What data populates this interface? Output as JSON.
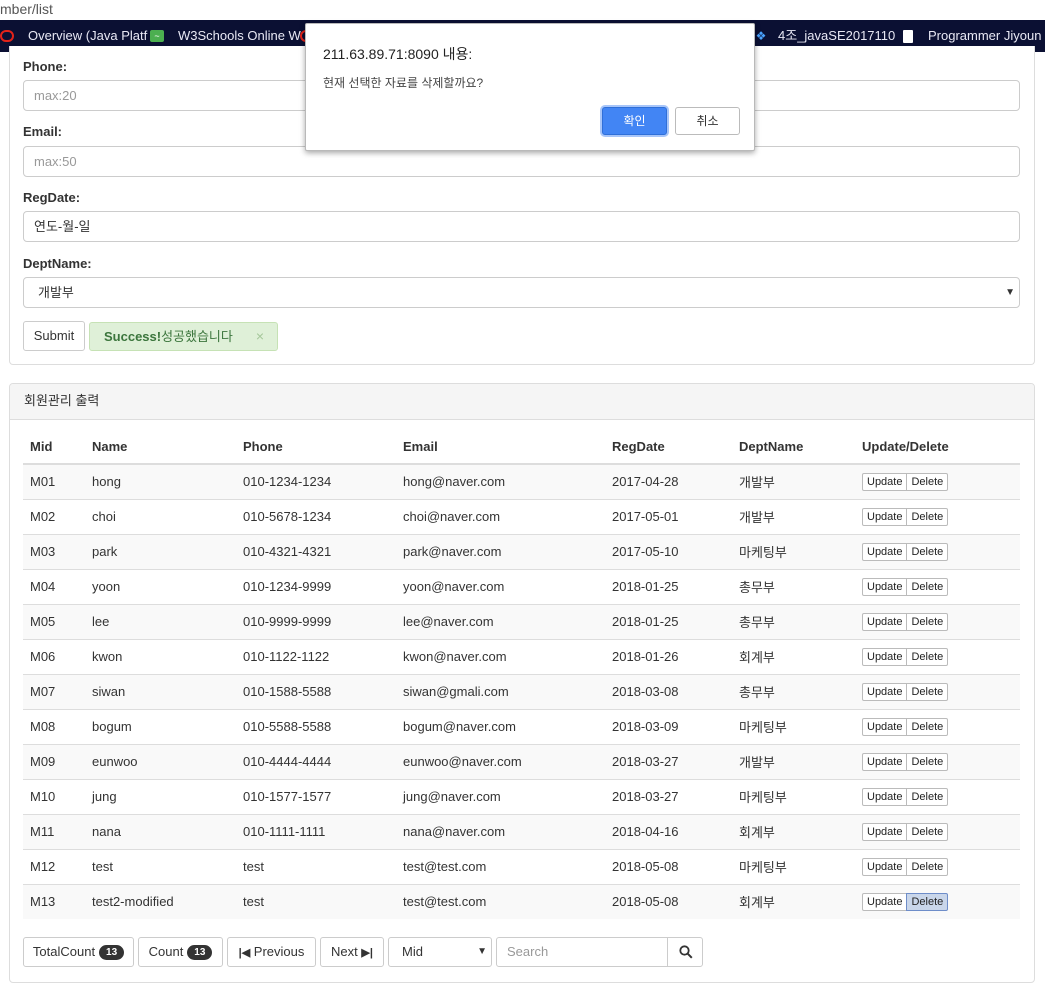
{
  "browser": {
    "url_fragment": "mber/list",
    "bookmarks": [
      {
        "label": "Overview (Java Platf",
        "icon": "oracle-icon"
      },
      {
        "label": "W3Schools Online W",
        "icon": "w3schools-icon"
      },
      {
        "label": "4조_javaSE2017110",
        "icon": "dropbox-icon"
      },
      {
        "label": "Programmer Jiyoun",
        "icon": "document-icon"
      }
    ]
  },
  "form": {
    "phone_label": "Phone:",
    "phone_placeholder": "max:20",
    "email_label": "Email:",
    "email_placeholder": "max:50",
    "regdate_label": "RegDate:",
    "regdate_value": "연도-월-일",
    "dept_label": "DeptName:",
    "dept_selected": "개발부",
    "submit_label": "Submit",
    "alert_strong": "Success!",
    "alert_text": "성공했습니다",
    "alert_close": "×"
  },
  "list": {
    "heading": "회원관리 출력",
    "columns": [
      "Mid",
      "Name",
      "Phone",
      "Email",
      "RegDate",
      "DeptName",
      "Update/Delete"
    ],
    "update_label": "Update",
    "delete_label": "Delete",
    "rows": [
      {
        "mid": "M01",
        "name": "hong",
        "phone": "010-1234-1234",
        "email": "hong@naver.com",
        "regdate": "2017-04-28",
        "dept": "개발부"
      },
      {
        "mid": "M02",
        "name": "choi",
        "phone": "010-5678-1234",
        "email": "choi@naver.com",
        "regdate": "2017-05-01",
        "dept": "개발부"
      },
      {
        "mid": "M03",
        "name": "park",
        "phone": "010-4321-4321",
        "email": "park@naver.com",
        "regdate": "2017-05-10",
        "dept": "마케팅부"
      },
      {
        "mid": "M04",
        "name": "yoon",
        "phone": "010-1234-9999",
        "email": "yoon@naver.com",
        "regdate": "2018-01-25",
        "dept": "총무부"
      },
      {
        "mid": "M05",
        "name": "lee",
        "phone": "010-9999-9999",
        "email": "lee@naver.com",
        "regdate": "2018-01-25",
        "dept": "총무부"
      },
      {
        "mid": "M06",
        "name": "kwon",
        "phone": "010-1122-1122",
        "email": "kwon@naver.com",
        "regdate": "2018-01-26",
        "dept": "회계부"
      },
      {
        "mid": "M07",
        "name": "siwan",
        "phone": "010-1588-5588",
        "email": "siwan@gmali.com",
        "regdate": "2018-03-08",
        "dept": "총무부"
      },
      {
        "mid": "M08",
        "name": "bogum",
        "phone": "010-5588-5588",
        "email": "bogum@naver.com",
        "regdate": "2018-03-09",
        "dept": "마케팅부"
      },
      {
        "mid": "M09",
        "name": "eunwoo",
        "phone": "010-4444-4444",
        "email": "eunwoo@naver.com",
        "regdate": "2018-03-27",
        "dept": "개발부"
      },
      {
        "mid": "M10",
        "name": "jung",
        "phone": "010-1577-1577",
        "email": "jung@naver.com",
        "regdate": "2018-03-27",
        "dept": "마케팅부"
      },
      {
        "mid": "M11",
        "name": "nana",
        "phone": "010-1111-1111",
        "email": "nana@naver.com",
        "regdate": "2018-04-16",
        "dept": "회계부"
      },
      {
        "mid": "M12",
        "name": "test",
        "phone": "test",
        "email": "test@test.com",
        "regdate": "2018-05-08",
        "dept": "마케팅부"
      },
      {
        "mid": "M13",
        "name": "test2-modified",
        "phone": "test",
        "email": "test@test.com",
        "regdate": "2018-05-08",
        "dept": "회계부"
      }
    ]
  },
  "pager": {
    "total_count_label": "TotalCount",
    "total_count": "13",
    "count_label": "Count",
    "count": "13",
    "previous_label": "Previous",
    "next_label": "Next",
    "search_field": "Mid",
    "search_placeholder": "Search"
  },
  "dialog": {
    "title": "211.63.89.71:8090 내용:",
    "message": "현재 선택한 자료를 삭제할까요?",
    "ok_label": "확인",
    "cancel_label": "취소"
  },
  "colors": {
    "dialog_ok": "#4285f4",
    "alert_bg": "#dff0d8",
    "bookmarks_bg": "#0b1033"
  }
}
